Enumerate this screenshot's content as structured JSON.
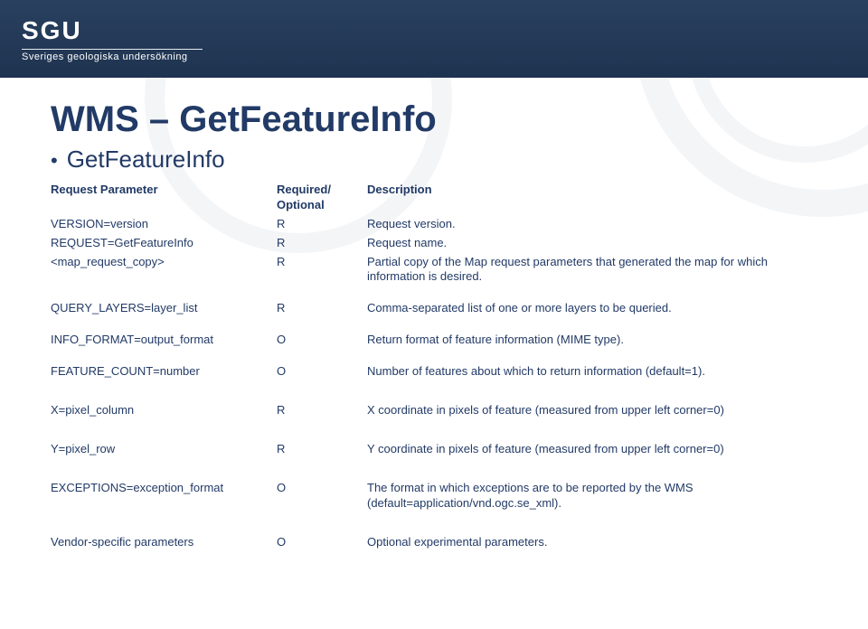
{
  "header": {
    "logo_text": "SGU",
    "logo_subtitle": "Sveriges geologiska undersökning"
  },
  "title": "WMS – GetFeatureInfo",
  "subtitle": "GetFeatureInfo",
  "cols": {
    "param": "Request Parameter",
    "req": "Required/\nOptional",
    "desc": "Description"
  },
  "rows": [
    {
      "param": "VERSION=version",
      "req": "R",
      "desc": "Request version."
    },
    {
      "param": "REQUEST=GetFeatureInfo",
      "req": "R",
      "desc": "Request name."
    },
    {
      "param": "<map_request_copy>",
      "req": "R",
      "desc": "Partial copy of the Map request parameters that generated the map for which information is desired."
    },
    {
      "param": "QUERY_LAYERS=layer_list",
      "req": "R",
      "desc": "Comma-separated list of one or more layers to be queried."
    },
    {
      "param": "INFO_FORMAT=output_format",
      "req": "O",
      "desc": "Return format of feature information (MIME type)."
    },
    {
      "param": "FEATURE_COUNT=number",
      "req": "O",
      "desc": "Number of features about which to return information (default=1)."
    },
    {
      "param": "X=pixel_column",
      "req": "R",
      "desc": "X coordinate in pixels of feature (measured from upper left corner=0)"
    },
    {
      "param": "Y=pixel_row",
      "req": "R",
      "desc": "Y coordinate in pixels of feature (measured from upper left corner=0)"
    },
    {
      "param": "EXCEPTIONS=exception_format",
      "req": "O",
      "desc": "The format in which exceptions are to be reported by the WMS (default=application/vnd.ogc.se_xml)."
    },
    {
      "param": "Vendor-specific parameters",
      "req": "O",
      "desc": "Optional experimental parameters."
    }
  ]
}
